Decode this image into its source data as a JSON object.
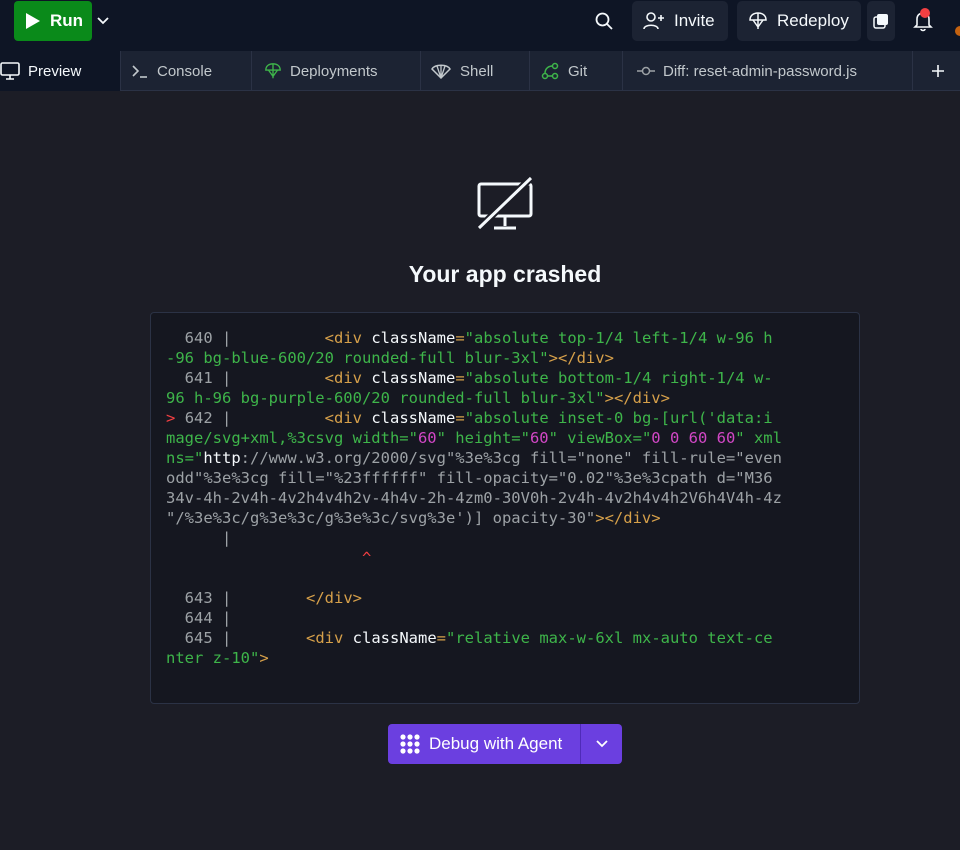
{
  "toolbar": {
    "run_label": "Run",
    "invite_label": "Invite",
    "redeploy_label": "Redeploy"
  },
  "tabs": [
    {
      "label": "Preview",
      "icon": "monitor-icon",
      "active": true
    },
    {
      "label": "Console",
      "icon": "terminal-icon",
      "active": false
    },
    {
      "label": "Deployments",
      "icon": "deploy-icon",
      "active": false
    },
    {
      "label": "Shell",
      "icon": "shell-icon",
      "active": false
    },
    {
      "label": "Git",
      "icon": "git-icon",
      "active": false
    },
    {
      "label": "Diff: reset-admin-password.js",
      "icon": "commit-icon",
      "active": false
    }
  ],
  "crash": {
    "title": "Your app crashed",
    "code_lines": {
      "l640_num": "640",
      "l640_code_a": "className",
      "l640_code_b": "\"absolute top-1/4 left-1/4 w-96 h",
      "l640_wrap": "-96 bg-blue-600/20 rounded-full blur-3xl\"",
      "l641_num": "641",
      "l641_code_b": "\"absolute bottom-1/4 right-1/4 w-",
      "l641_wrap": "96 h-96 bg-purple-600/20 rounded-full blur-3xl\"",
      "l642_num": "642",
      "l642_code_b": "\"absolute inset-0 bg-[url('data:i",
      "l642_w1a": "mage/svg+xml,%3csvg width=\"",
      "l642_w1b": "60",
      "l642_w1c": "\" height=\"",
      "l642_w1d": "60",
      "l642_w1e": "\" viewBox=\"",
      "l642_w1f": "0 0 60 60",
      "l642_w1g": "\" xml",
      "l642_w2a": "ns=\"",
      "l642_w2b": "http",
      "l642_w2c": "://www.w3.org/2000/svg\"%3e%3cg fill=\"none\" fill-rule=\"even",
      "l642_w3": "odd\"%3e%3cg fill=\"%23ffffff\" fill-opacity=\"0.02\"%3e%3cpath d=\"M36",
      "l642_w4": "34v-4h-2v4h-4v2h4v4h2v-4h4v-2h-4zm0-30V0h-2v4h-4v2h4v4h2V6h4V4h-4z",
      "l642_w5a": "\"/%3e%3c/g%3e%3c/g%3e%3c/svg%3e')] opacity-30\"",
      "l643_num": "643",
      "l644_num": "644",
      "l645_num": "645",
      "l645_code_b": "\"relative max-w-6xl mx-auto text-ce",
      "l645_wrap": "nter z-10\""
    }
  },
  "debug": {
    "label": "Debug with Agent"
  },
  "colors": {
    "run_green": "#0a8a1a",
    "agent_purple": "#6b3fe0",
    "notification_red": "#f23f42"
  }
}
